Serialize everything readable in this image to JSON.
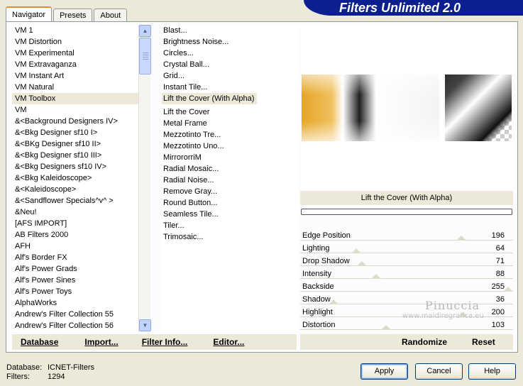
{
  "window": {
    "title": "Filters Unlimited 2.0"
  },
  "tabs": [
    "Navigator",
    "Presets",
    "About"
  ],
  "categories": [
    "VM 1",
    "VM Distortion",
    "VM Experimental",
    "VM Extravaganza",
    "VM Instant Art",
    "VM Natural",
    "VM Toolbox",
    "VM",
    "&<Background Designers IV>",
    "&<Bkg Designer sf10 I>",
    "&<BKg Designer sf10 II>",
    "&<Bkg Designer sf10 III>",
    "&<Bkg Designers sf10 IV>",
    "&<Bkg Kaleidoscope>",
    "&<Kaleidoscope>",
    "&<Sandflower Specials^v^ >",
    "&Neu!",
    "[AFS IMPORT]",
    "AB Filters 2000",
    "AFH",
    "Alf's Border FX",
    "Alf's Power Grads",
    "Alf's Power Sines",
    "Alf's Power Toys",
    "AlphaWorks",
    "Andrew's Filter Collection 55",
    "Andrew's Filter Collection 56"
  ],
  "selected_category": "VM Toolbox",
  "filters": [
    "Blast...",
    "Brightness Noise...",
    "Circles...",
    "Crystal Ball...",
    "Grid...",
    "Instant Tile...",
    "Lift the Cover (With Alpha)",
    "Lift the Cover",
    "Metal Frame",
    "Mezzotinto Tre...",
    "Mezzotinto Uno...",
    "MirrororriM",
    "Radial Mosaic...",
    "Radial Noise...",
    "Remove Gray...",
    "Round Button...",
    "Seamless Tile...",
    "Tiler...",
    "Trimosaic..."
  ],
  "selected_filter": "Lift the Cover (With Alpha)",
  "current_filter_name": "Lift the Cover (With Alpha)",
  "parameters": [
    {
      "label": "Edge Position",
      "value": "196",
      "level": 0.77
    },
    {
      "label": "Lighting",
      "value": "64",
      "level": 0.25
    },
    {
      "label": "Drop Shadow",
      "value": "71",
      "level": 0.28
    },
    {
      "label": "Intensity",
      "value": "88",
      "level": 0.35
    },
    {
      "label": "Backside",
      "value": "255",
      "level": 1.0
    },
    {
      "label": "Shadow",
      "value": "36",
      "level": 0.14
    },
    {
      "label": "Highlight",
      "value": "200",
      "level": 0.78
    },
    {
      "label": "Distortion",
      "value": "103",
      "level": 0.4
    }
  ],
  "bottom_buttons": {
    "database": "Database",
    "import": "Import...",
    "filter_info": "Filter Info...",
    "editor": "Editor...",
    "randomize": "Randomize",
    "reset": "Reset"
  },
  "watermark": {
    "line1": "Pinuccia",
    "line2": "www.maidiregrafica.eu"
  },
  "info": {
    "database_label": "Database:",
    "database_value": "ICNET-Filters",
    "filters_label": "Filters:",
    "filters_value": "1294"
  },
  "dialog_buttons": {
    "apply": "Apply",
    "cancel": "Cancel",
    "help": "Help"
  }
}
